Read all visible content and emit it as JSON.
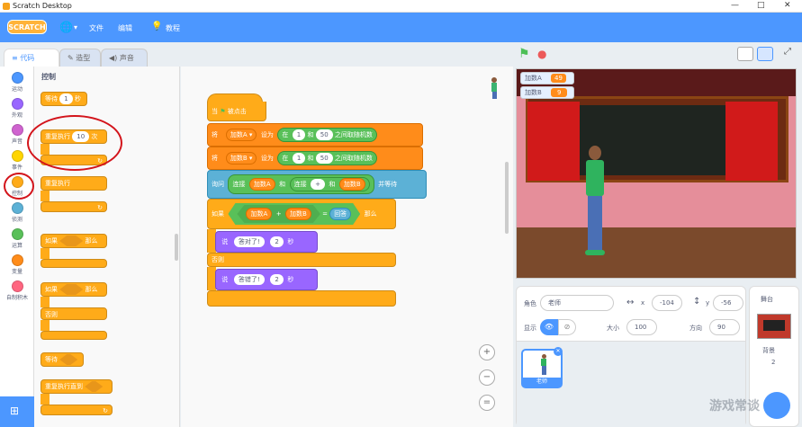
{
  "window": {
    "title": "Scratch Desktop",
    "controls": [
      "—",
      "□",
      "✕"
    ]
  },
  "menubar": {
    "logo": "SCRATCH",
    "file": "文件",
    "edit": "编辑",
    "tutorials": "教程",
    "globe": "🌐",
    "chev": "▾",
    "bulb": "💡"
  },
  "tabs": {
    "code": "代码",
    "costumes": "造型",
    "sounds": "声音",
    "code_icon": "≡",
    "costume_icon": "✎",
    "sound_icon": "◀)"
  },
  "categories": [
    {
      "label": "运动",
      "color": "#4c97ff"
    },
    {
      "label": "外观",
      "color": "#9966ff"
    },
    {
      "label": "声音",
      "color": "#cf63cf"
    },
    {
      "label": "事件",
      "color": "#ffd500"
    },
    {
      "label": "控制",
      "color": "#ffab19"
    },
    {
      "label": "侦测",
      "color": "#5cb1d6"
    },
    {
      "label": "运算",
      "color": "#59c059"
    },
    {
      "label": "变量",
      "color": "#ff8c1a"
    },
    {
      "label": "自制积木",
      "color": "#ff6680"
    }
  ],
  "palette": {
    "heading": "控制",
    "wait": "等待",
    "wait_val": "1",
    "wait_unit": "秒",
    "repeat": "重复执行",
    "repeat_val": "10",
    "repeat_unit": "次",
    "forever": "重复执行",
    "if": "如果",
    "then": "那么",
    "if2": "如果",
    "then2": "那么",
    "else": "否则",
    "wait_until": "等待",
    "repeat_until": "重复执行直到",
    "loop_arrow": "↻"
  },
  "script": {
    "hat": "当",
    "hat_flag": "⚑",
    "hat_click": "被点击",
    "set1_pre": "将",
    "set1_var": "加数A ▾",
    "set1_mid": "设为",
    "set1_rand_pre": "在",
    "set1_from": "1",
    "set1_and": "和",
    "set1_to": "50",
    "set1_rand_post": "之间取随机数",
    "set2_pre": "将",
    "set2_var": "加数B ▾",
    "set2_mid": "设为",
    "set2_rand_pre": "在",
    "set2_from": "1",
    "set2_and": "和",
    "set2_to": "50",
    "set2_rand_post": "之间取随机数",
    "ask": "询问",
    "join1": "连接",
    "ask_a": "加数A",
    "ask_and": "和",
    "join2": "连接",
    "ask_plus": "+",
    "ask_and2": "和",
    "ask_b": "加数B",
    "ask_wait": "并等待",
    "if": "如果",
    "cond_a": "加数A",
    "cond_plus": "+",
    "cond_b": "加数B",
    "cond_eq": "=",
    "cond_answer": "回答",
    "then": "那么",
    "say1": "说",
    "say1_text": "答对了!",
    "say1_secs": "2",
    "say1_unit": "秒",
    "else": "否则",
    "say2": "说",
    "say2_text": "答错了!",
    "say2_secs": "2",
    "say2_unit": "秒"
  },
  "zoom": {
    "in": "+",
    "out": "−",
    "reset": "="
  },
  "stage": {
    "flag": "⚑",
    "stop": "●",
    "var_a_label": "加数A",
    "var_a_value": "49",
    "var_b_label": "加数B",
    "var_b_value": "9"
  },
  "sprite_info": {
    "sprite_label": "角色",
    "sprite_name": "老师",
    "x_icon": "↔",
    "x_label": "x",
    "x_val": "-104",
    "y_icon": "↕",
    "y_label": "y",
    "y_val": "-56",
    "show_label": "显示",
    "show_on": "👁",
    "show_off": "⊘",
    "size_label": "大小",
    "size_val": "100",
    "dir_label": "方向",
    "dir_val": "90"
  },
  "sprite_list": [
    {
      "name": "老师"
    }
  ],
  "stage_pane": {
    "title": "舞台",
    "backdrops_label": "背景",
    "backdrops_count": "2"
  },
  "watermark": "游戏常谈"
}
